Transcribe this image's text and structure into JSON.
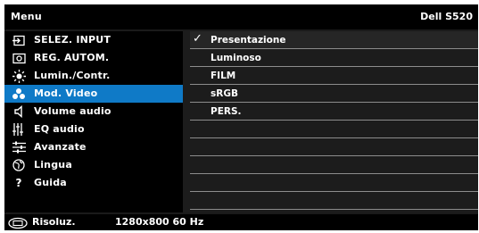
{
  "header": {
    "title": "Menu",
    "model": "Dell S520"
  },
  "menu": [
    {
      "label": "SELEZ. INPUT",
      "icon": "input-select-icon",
      "selected": false
    },
    {
      "label": "REG. AUTOM.",
      "icon": "auto-adjust-icon",
      "selected": false
    },
    {
      "label": "Lumin./Contr.",
      "icon": "brightness-icon",
      "selected": false
    },
    {
      "label": "Mod. Video",
      "icon": "video-mode-icon",
      "selected": true
    },
    {
      "label": "Volume audio",
      "icon": "speaker-icon",
      "selected": false
    },
    {
      "label": "EQ audio",
      "icon": "equalizer-icon",
      "selected": false
    },
    {
      "label": "Avanzate",
      "icon": "advanced-settings-icon",
      "selected": false
    },
    {
      "label": "Lingua",
      "icon": "globe-icon",
      "selected": false
    },
    {
      "label": "Guida",
      "icon": "help-icon",
      "selected": false
    }
  ],
  "options": [
    {
      "label": "Presentazione",
      "checked": true
    },
    {
      "label": "Luminoso",
      "checked": false
    },
    {
      "label": "FILM",
      "checked": false
    },
    {
      "label": "sRGB",
      "checked": false
    },
    {
      "label": "PERS.",
      "checked": false
    },
    {
      "label": "",
      "checked": false
    },
    {
      "label": "",
      "checked": false
    },
    {
      "label": "",
      "checked": false
    },
    {
      "label": "",
      "checked": false
    },
    {
      "label": "",
      "checked": false
    }
  ],
  "footer": {
    "label": "Risoluz.",
    "value": "1280x800 60 Hz",
    "icon": "resolution-icon"
  },
  "colors": {
    "selected": "#0f7ac7",
    "background": "#1a1a1a"
  }
}
